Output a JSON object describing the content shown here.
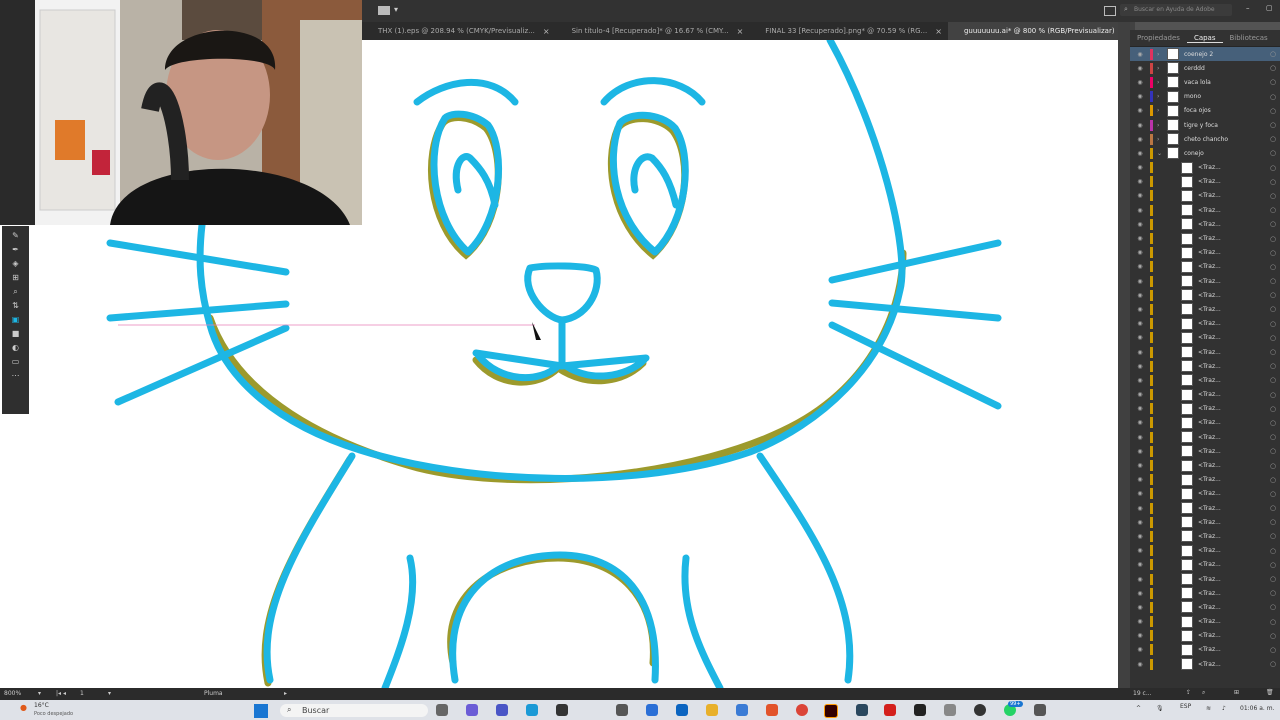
{
  "topbar": {
    "search_placeholder": "Buscar en Ayuda de Adobe"
  },
  "tabs": [
    {
      "label": "THX (1).eps @ 208.94 % (CMYK/Previsualiz..."
    },
    {
      "label": "Sin título-4 [Recuperado]* @ 16.67 % (CMY..."
    },
    {
      "label": "FINAL 33 [Recuperado].png* @ 70.59 % (RG..."
    },
    {
      "label": "guuuuuuu.ai* @ 800 % (RGB/Previsualizar)"
    }
  ],
  "panel": {
    "tabs": [
      "Propiedades",
      "Capas",
      "Bibliotecas"
    ],
    "layers": [
      {
        "name": "coenejo 2",
        "color": "#e0325f"
      },
      {
        "name": "cerddd",
        "color": "#c44"
      },
      {
        "name": "vaca lola",
        "color": "#e06"
      },
      {
        "name": "mono",
        "color": "#33b"
      },
      {
        "name": "foca ojos",
        "color": "#d90"
      },
      {
        "name": "tigre y foca",
        "color": "#b3a"
      },
      {
        "name": "cheto chancho",
        "color": "#b74"
      },
      {
        "name": "conejo",
        "color": "#c90"
      }
    ],
    "sublayer_name": "<Traz...",
    "footer_count": "19 c..."
  },
  "status": {
    "zoom": "800%",
    "artboard": "1",
    "tool": "Pluma"
  },
  "taskbar": {
    "weather_temp": "16°C",
    "weather_desc": "Poco despejado",
    "search_label": "Buscar",
    "badge_count": "99+",
    "lang": "ESP",
    "time": "01:06 a. m."
  },
  "colors": {
    "stroke": "#1db6e4",
    "shadow_stroke": "#9c9a2c",
    "guide": "#e87fb8"
  }
}
